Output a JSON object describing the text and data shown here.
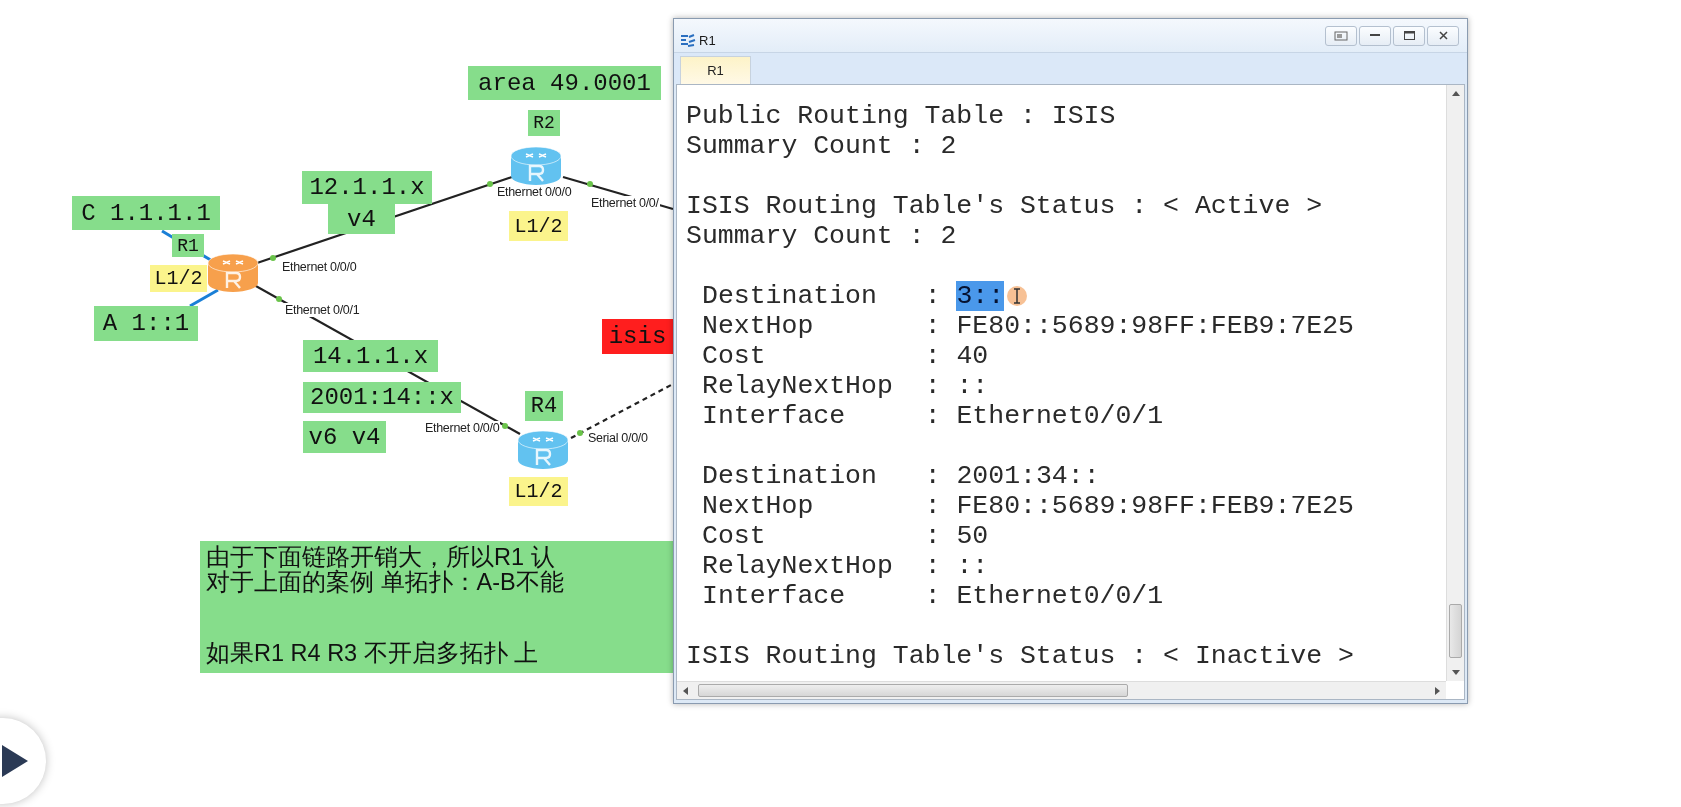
{
  "diagram": {
    "labels": [
      {
        "text": "area 49.0001",
        "kind": "note"
      },
      {
        "text": "R2",
        "kind": "note"
      },
      {
        "text": "12.1.1.x",
        "kind": "note"
      },
      {
        "text": "C 1.1.1.1",
        "kind": "note"
      },
      {
        "text": "v4",
        "kind": "note"
      },
      {
        "text": "L1/2",
        "kind": "level"
      },
      {
        "text": "R1",
        "kind": "note"
      },
      {
        "text": "L1/2",
        "kind": "level"
      },
      {
        "text": "A 1::1",
        "kind": "note"
      },
      {
        "text": "isis",
        "kind": "alert"
      },
      {
        "text": "14.1.1.x",
        "kind": "note"
      },
      {
        "text": "2001:14::x",
        "kind": "note"
      },
      {
        "text": "R4",
        "kind": "note"
      },
      {
        "text": "v6 v4",
        "kind": "note"
      },
      {
        "text": "L1/2",
        "kind": "level"
      }
    ],
    "routers": [
      {
        "color": "#f7a04c"
      },
      {
        "color": "#62c2f0"
      },
      {
        "color": "#62c2f0"
      }
    ],
    "ports": [
      "Ethernet 0/0/0",
      "Ethernet 0/0/1",
      "Ethernet 0/0/0",
      "Ethernet 0/0/",
      "Ethernet 0/0/0",
      "Serial 0/0/0"
    ]
  },
  "note": {
    "paragraphs": [
      [
        "由于下面链路开销大，所以R1 认",
        "对于上面的案例 单拓扑：A-B不能"
      ],
      [
        "如果R1 R4   R3 不开启多拓扑 上"
      ]
    ]
  },
  "terminal": {
    "title": "R1",
    "tabs": [
      {
        "label": "R1",
        "selected": true
      }
    ],
    "output": [
      {
        "kind": "line",
        "text": "Public Routing Table : ISIS"
      },
      {
        "kind": "line",
        "text": "Summary Count : 2"
      },
      {
        "kind": "gap"
      },
      {
        "kind": "line",
        "text": "ISIS Routing Table's Status : < Active >"
      },
      {
        "kind": "line",
        "text": "Summary Count : 2"
      },
      {
        "kind": "gap"
      },
      {
        "kind": "field",
        "label": "Destination",
        "sep": ":",
        "value": "3::",
        "selected": true
      },
      {
        "kind": "field",
        "label": "NextHop",
        "sep": ":",
        "value": "FE80::5689:98FF:FEB9:7E25",
        "selected": false
      },
      {
        "kind": "field",
        "label": "Cost",
        "sep": ":",
        "value": "40",
        "selected": false
      },
      {
        "kind": "field",
        "label": "RelayNextHop",
        "sep": ":",
        "value": "::",
        "selected": false
      },
      {
        "kind": "field",
        "label": "Interface",
        "sep": ":",
        "value": "Ethernet0/0/1",
        "selected": false
      },
      {
        "kind": "gap"
      },
      {
        "kind": "field",
        "label": "Destination",
        "sep": ":",
        "value": "2001:34::",
        "selected": false
      },
      {
        "kind": "field",
        "label": "NextHop",
        "sep": ":",
        "value": "FE80::5689:98FF:FEB9:7E25",
        "selected": false
      },
      {
        "kind": "field",
        "label": "Cost",
        "sep": ":",
        "value": "50",
        "selected": false
      },
      {
        "kind": "field",
        "label": "RelayNextHop",
        "sep": ":",
        "value": "::",
        "selected": false
      },
      {
        "kind": "field",
        "label": "Interface",
        "sep": ":",
        "value": "Ethernet0/0/1",
        "selected": false
      },
      {
        "kind": "gap"
      },
      {
        "kind": "line",
        "text": "ISIS Routing Table's Status : < Inactive >"
      }
    ]
  }
}
